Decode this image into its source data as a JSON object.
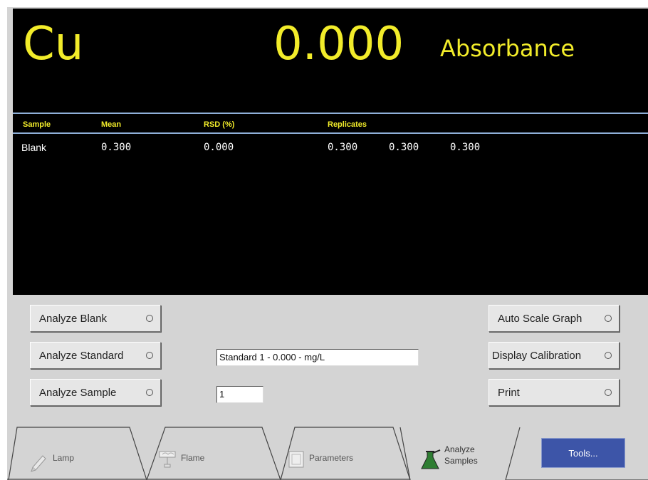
{
  "display": {
    "element": "Cu",
    "reading": "0.000",
    "unit": "Absorbance"
  },
  "results": {
    "headers": [
      "Sample",
      "Mean",
      "RSD (%)",
      "Replicates"
    ],
    "rows": [
      {
        "sample": "Blank",
        "mean": "0.300",
        "rsd": "0.000",
        "replicates": [
          "0.300",
          "0.300",
          "0.300"
        ]
      }
    ]
  },
  "buttons": {
    "analyze_blank": "Analyze Blank",
    "analyze_standard": "Analyze Standard",
    "analyze_sample": "Analyze Sample",
    "auto_scale": "Auto Scale Graph",
    "display_calibration": "Display Calibration",
    "print": "Print"
  },
  "inputs": {
    "standard_value": "Standard 1 - 0.000 - mg/L",
    "sample_value": "1"
  },
  "tabs": {
    "lamp": "Lamp",
    "flame": "Flame",
    "parameters": "Parameters",
    "analyze_line1": "Analyze",
    "analyze_line2": "Samples",
    "tools": "Tools..."
  },
  "colors": {
    "display_bg": "#000000",
    "reading_text": "#f2ec2a",
    "panel_bg": "#d4d4d4",
    "tools_button": "#3d55a8"
  }
}
